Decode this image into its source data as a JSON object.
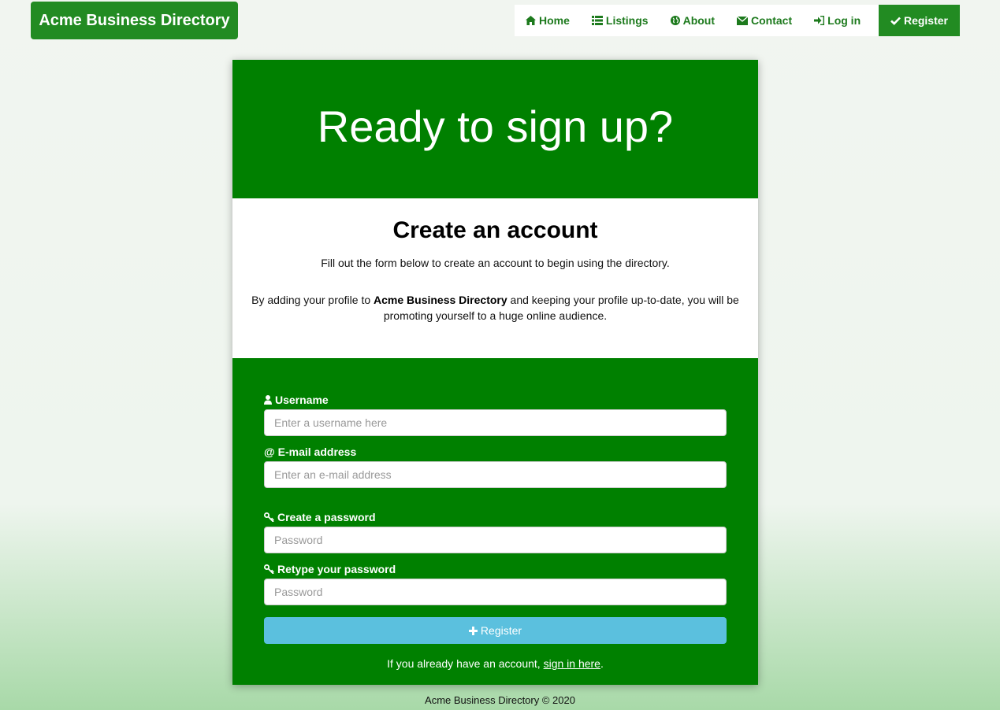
{
  "brand": "Acme Business Directory",
  "nav": {
    "home": "Home",
    "listings": "Listings",
    "about": "About",
    "contact": "Contact",
    "login": "Log in",
    "register": "Register"
  },
  "hero": {
    "title": "Ready to sign up?"
  },
  "intro": {
    "heading": "Create an account",
    "lead": "Fill out the form below to create an account to begin using the directory.",
    "desc_before": "By adding your profile to ",
    "desc_bold": "Acme Business Directory",
    "desc_after": " and keeping your profile up-to-date, you will be promoting yourself to a huge online audience."
  },
  "form": {
    "username_label": "Username",
    "username_placeholder": "Enter a username here",
    "email_label": "E-mail address",
    "email_prefix": "@",
    "email_placeholder": "Enter an e-mail address",
    "password_label": "Create a password",
    "password_placeholder": "Password",
    "retype_label": "Retype your password",
    "retype_placeholder": "Password",
    "submit_label": "Register",
    "signin_before": "If you already have an account, ",
    "signin_link": "sign in here",
    "signin_after": "."
  },
  "footer": "Acme Business Directory © 2020",
  "icons": {
    "home": "home-icon",
    "listings": "list-icon",
    "about": "globe-icon",
    "contact": "envelope-icon",
    "login": "log-in-icon",
    "register": "check-icon",
    "username": "user-icon",
    "password": "key-icon",
    "submit": "plus-icon"
  },
  "colors": {
    "brand_green": "#228b22",
    "panel_green": "#008000",
    "nav_text": "#1d7a1d",
    "button_blue": "#5bc0de"
  }
}
